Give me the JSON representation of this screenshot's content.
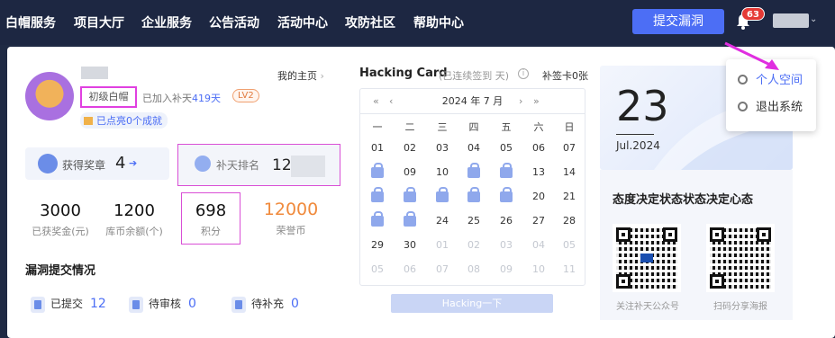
{
  "nav": {
    "items": [
      "白帽服务",
      "项目大厅",
      "企业服务",
      "公告活动",
      "活动中心",
      "攻防社区",
      "帮助中心"
    ],
    "submit_label": "提交漏洞",
    "notification_count": "63"
  },
  "profile": {
    "my_home": "我的主页",
    "rank_tag": "初级白帽",
    "joined_prefix": "已加入补天",
    "joined_days": "419天",
    "level": "LV2",
    "achievements": "已点亮0个成就",
    "medal_label": "获得奖章",
    "medal_value": "4",
    "rank_label": "补天排名",
    "rank_value": "12"
  },
  "stats": [
    {
      "value": "3000",
      "label": "已获奖金(元)"
    },
    {
      "value": "1200",
      "label": "库币余额(个)"
    },
    {
      "value": "698",
      "label": "积分"
    },
    {
      "value": "12000",
      "label": "荣誉币"
    }
  ],
  "vuln": {
    "title": "漏洞提交情况",
    "items": [
      {
        "label": "已提交",
        "count": "12"
      },
      {
        "label": "待审核",
        "count": "0"
      },
      {
        "label": "待补充",
        "count": "0"
      }
    ]
  },
  "hacking": {
    "title": "Hacking Card",
    "subtitle": "(已连续签到  天)",
    "info": "i",
    "makeup": "补签卡0张",
    "month": "2024 年 7 月",
    "weekdays": [
      "一",
      "二",
      "三",
      "四",
      "五",
      "六",
      "日"
    ],
    "button": "Hacking一下",
    "prev_year": "«",
    "prev_month": "‹",
    "next_month": "›",
    "next_year": "»",
    "rows": [
      [
        "01",
        "02",
        "03",
        "04",
        "05",
        "06",
        "07"
      ],
      [
        "L",
        "09",
        "10",
        "L",
        "L",
        "13",
        "14"
      ],
      [
        "L",
        "L",
        "L",
        "L",
        "L",
        "20",
        "21"
      ],
      [
        "L",
        "L",
        "24",
        "25",
        "26",
        "27",
        "28"
      ],
      [
        "29",
        "30",
        "o01",
        "o02",
        "o03",
        "o04",
        "o05"
      ],
      [
        "o05",
        "o06",
        "o07",
        "o08",
        "o09",
        "o10",
        "o11"
      ]
    ]
  },
  "date_card": {
    "day": "23",
    "month": "Jul.2024"
  },
  "motto": {
    "text": "态度决定状态状态决定心态",
    "qr1_caption": "关注补天公众号",
    "qr2_caption": "扫码分享海报"
  },
  "dropdown": {
    "items": [
      "个人空间",
      "退出系统"
    ]
  }
}
